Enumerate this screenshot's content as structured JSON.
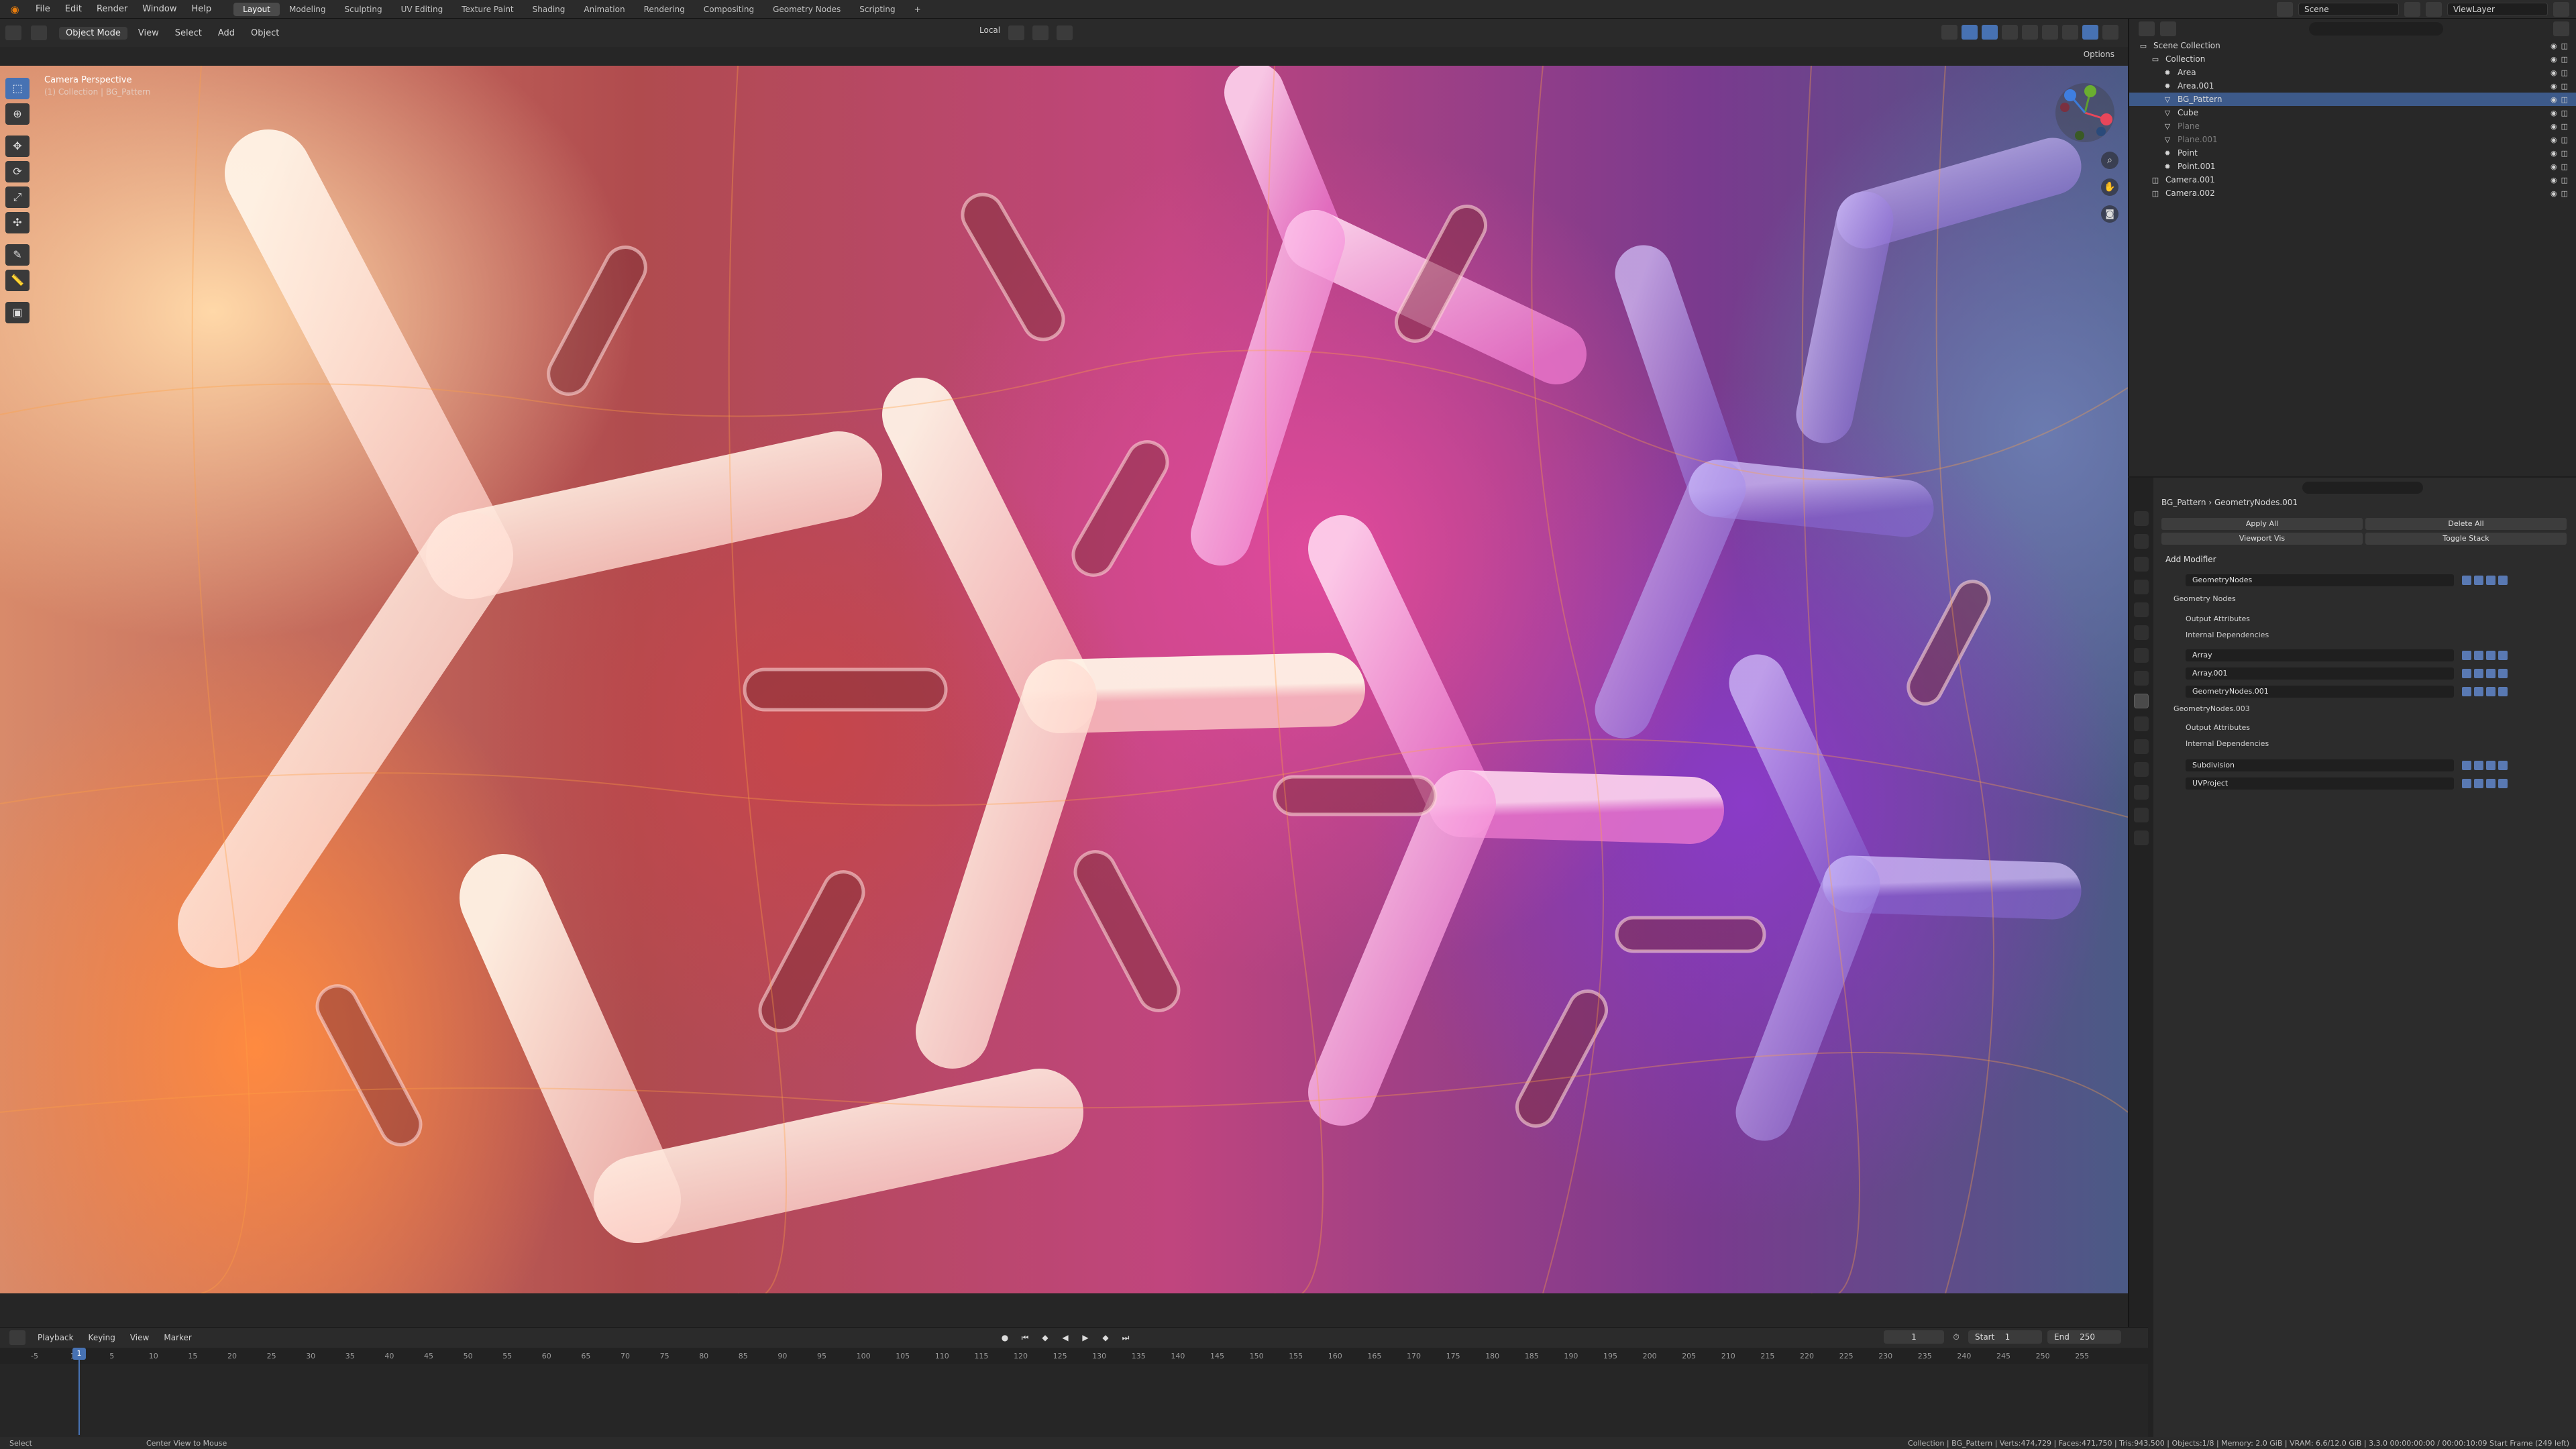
{
  "topbar": {
    "menus": [
      "File",
      "Edit",
      "Render",
      "Window",
      "Help"
    ],
    "workspaces": [
      "Layout",
      "Modeling",
      "Sculpting",
      "UV Editing",
      "Texture Paint",
      "Shading",
      "Animation",
      "Rendering",
      "Compositing",
      "Geometry Nodes",
      "Scripting"
    ],
    "add_tab": "+",
    "scene": "Scene",
    "view_layer": "ViewLayer"
  },
  "viewport": {
    "mode": "Object Mode",
    "menus": [
      "View",
      "Select",
      "Add",
      "Object"
    ],
    "orientation": "Local",
    "options": "Options",
    "camera_label": "Camera Perspective",
    "camera_sub": "(1) Collection | BG_Pattern"
  },
  "outliner": {
    "rows": [
      {
        "name": "Scene Collection",
        "icon": "collection-icon",
        "indent": 0,
        "selected": false,
        "dim": false
      },
      {
        "name": "Collection",
        "icon": "collection-icon",
        "indent": 1,
        "selected": false,
        "dim": false
      },
      {
        "name": "Area",
        "icon": "light-icon",
        "indent": 2,
        "selected": false,
        "dim": false
      },
      {
        "name": "Area.001",
        "icon": "light-icon",
        "indent": 2,
        "selected": false,
        "dim": false
      },
      {
        "name": "BG_Pattern",
        "icon": "mesh-icon",
        "indent": 2,
        "selected": true,
        "dim": false
      },
      {
        "name": "Cube",
        "icon": "mesh-icon",
        "indent": 2,
        "selected": false,
        "dim": false
      },
      {
        "name": "Plane",
        "icon": "mesh-icon",
        "indent": 2,
        "selected": false,
        "dim": true
      },
      {
        "name": "Plane.001",
        "icon": "mesh-icon",
        "indent": 2,
        "selected": false,
        "dim": true
      },
      {
        "name": "Point",
        "icon": "light-icon",
        "indent": 2,
        "selected": false,
        "dim": false
      },
      {
        "name": "Point.001",
        "icon": "light-icon",
        "indent": 2,
        "selected": false,
        "dim": false
      },
      {
        "name": "Camera.001",
        "icon": "camera-icon",
        "indent": 1,
        "selected": false,
        "dim": false
      },
      {
        "name": "Camera.002",
        "icon": "camera-icon",
        "indent": 1,
        "selected": false,
        "dim": false
      }
    ]
  },
  "properties": {
    "breadcrumb_object": "BG_Pattern",
    "breadcrumb_modifier": "GeometryNodes.001",
    "apply_all": "Apply All",
    "delete_all": "Delete All",
    "viewport_vis": "Viewport Vis",
    "toggle_stack": "Toggle Stack",
    "add_modifier": "Add Modifier",
    "mod1_name": "GeometryNodes",
    "mod1_tree": "Geometry Nodes",
    "output_attributes": "Output Attributes",
    "internal_dependencies": "Internal Dependencies",
    "mod2_name": "Array",
    "mod3_name": "Array.001",
    "mod4_name": "GeometryNodes.001",
    "mod4_tree": "GeometryNodes.003",
    "mod5_name": "Subdivision",
    "mod6_name": "UVProject"
  },
  "timeline": {
    "menus": [
      "Playback",
      "Keying",
      "View",
      "Marker"
    ],
    "current_frame": "1",
    "start_label": "Start",
    "start": "1",
    "end_label": "End",
    "end": "250",
    "ticks": [
      "-5",
      "1",
      "5",
      "10",
      "15",
      "20",
      "25",
      "30",
      "35",
      "40",
      "45",
      "50",
      "55",
      "60",
      "65",
      "70",
      "75",
      "80",
      "85",
      "90",
      "95",
      "100",
      "105",
      "110",
      "115",
      "120",
      "125",
      "130",
      "135",
      "140",
      "145",
      "150",
      "155",
      "160",
      "165",
      "170",
      "175",
      "180",
      "185",
      "190",
      "195",
      "200",
      "205",
      "210",
      "215",
      "220",
      "225",
      "230",
      "235",
      "240",
      "245",
      "250",
      "255"
    ]
  },
  "statusbar": {
    "left": "Select",
    "middle": "Center View to Mouse",
    "right": "Collection | BG_Pattern | Verts:474,729 | Faces:471,750 | Tris:943,500 | Objects:1/8 | Memory: 2.0 GiB | VRAM: 6.6/12.0 GiB | 3.3.0 00:00:00:00 / 00:00:10:09 Start Frame (249 left)"
  }
}
